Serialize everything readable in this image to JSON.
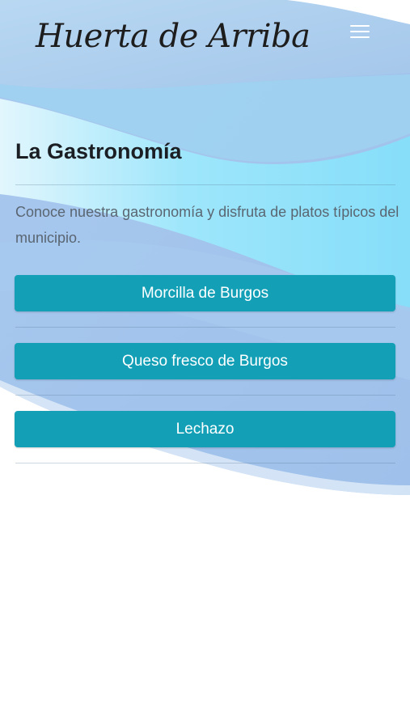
{
  "header": {
    "logo_text": "Huerta de Arriba",
    "menu_icon": "hamburger-menu-icon"
  },
  "main": {
    "title": "La Gastronomía",
    "intro": "Conoce nuestra gastronomía y disfruta de platos típicos del municipio.",
    "dishes": [
      {
        "label": "Morcilla de Burgos"
      },
      {
        "label": "Queso fresco de Burgos"
      },
      {
        "label": "Lechazo"
      }
    ]
  },
  "colors": {
    "button": "#13a0b7",
    "button_text": "#ffffff",
    "wave_light": "#a9cdea",
    "wave_cyan": "#8fe4fb"
  }
}
